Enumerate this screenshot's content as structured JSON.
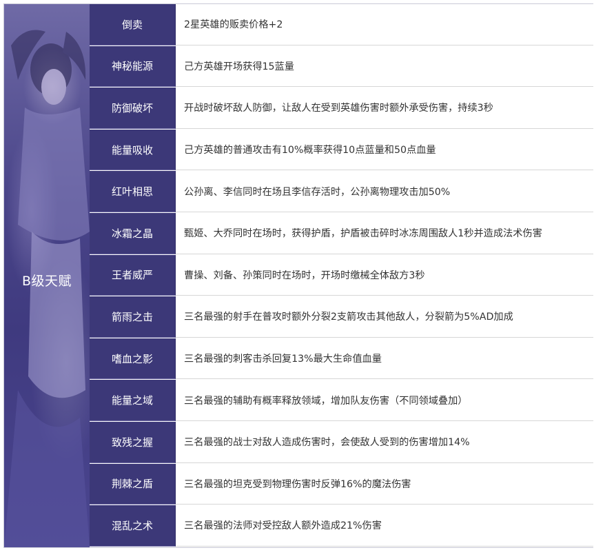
{
  "category": "B级天赋",
  "rows": [
    {
      "name": "倒卖",
      "desc": "2星英雄的贩卖价格+2"
    },
    {
      "name": "神秘能源",
      "desc": "己方英雄开场获得15蓝量"
    },
    {
      "name": "防御破坏",
      "desc": "开战时破坏敌人防御，让敌人在受到英雄伤害时额外承受伤害，持续3秒"
    },
    {
      "name": "能量吸收",
      "desc": "己方英雄的普通攻击有10%概率获得10点蓝量和50点血量"
    },
    {
      "name": "红叶相思",
      "desc": "公孙离、李信同时在场且李信存活时，公孙离物理攻击加50%"
    },
    {
      "name": "冰霜之晶",
      "desc": "甄姬、大乔同时在场时，获得护盾，护盾被击碎时冰冻周围敌人1秒并造成法术伤害"
    },
    {
      "name": "王者威严",
      "desc": "曹操、刘备、孙策同时在场时，开场时缴械全体敌方3秒"
    },
    {
      "name": "箭雨之击",
      "desc": "三名最强的射手在普攻时额外分裂2支箭攻击其他敌人，分裂箭为5%AD加成"
    },
    {
      "name": "嗜血之影",
      "desc": "三名最强的刺客击杀回复13%最大生命值血量"
    },
    {
      "name": "能量之域",
      "desc": "三名最强的辅助有概率释放领域，增加队友伤害（不同领域叠加）"
    },
    {
      "name": "致残之握",
      "desc": "三名最强的战士对敌人造成伤害时，会使敌人受到的伤害增加14%"
    },
    {
      "name": "荆棘之盾",
      "desc": "三名最强的坦克受到物理伤害时反弹16%的魔法伤害"
    },
    {
      "name": "混乱之术",
      "desc": "三名最强的法师对受控敌人额外造成21%伤害"
    }
  ]
}
